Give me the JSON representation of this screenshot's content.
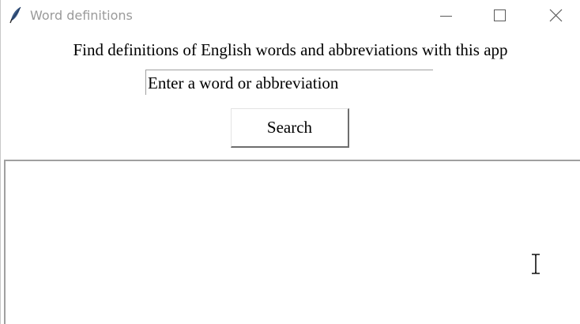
{
  "window": {
    "title": "Word definitions",
    "icon": "feather-icon",
    "controls": [
      "minimize-icon",
      "maximize-icon",
      "close-icon"
    ]
  },
  "main": {
    "heading": "Find definitions of English words and abbreviations with this app",
    "entry_value": "Enter a word or abbreviation",
    "search_label": "Search",
    "output_text": ""
  },
  "pointer": {
    "icon": "text-cursor-icon"
  },
  "colors": {
    "title_text": "#9a9a9a",
    "border": "#a0a0a0",
    "button_shadow": "#6e6e6e"
  }
}
